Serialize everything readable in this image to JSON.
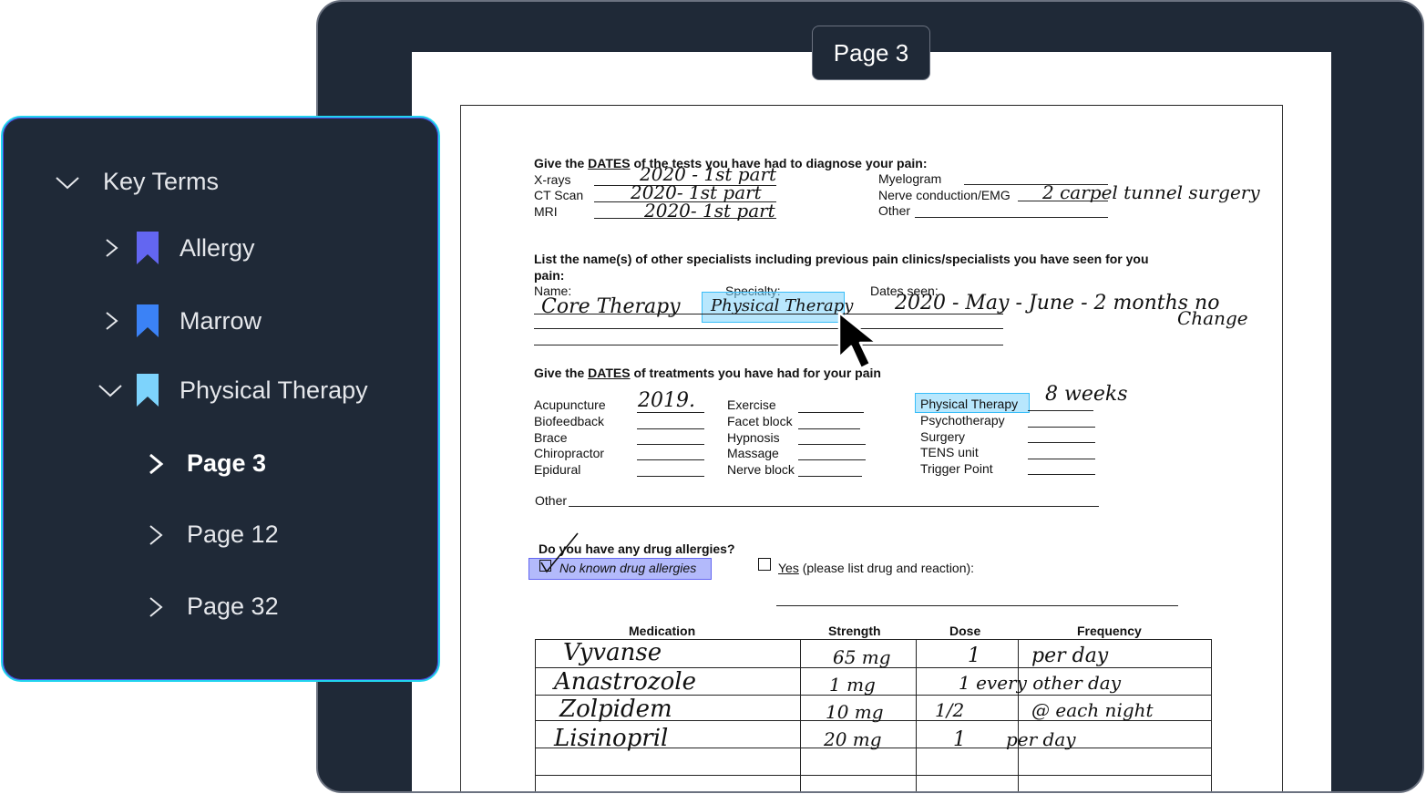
{
  "viewer": {
    "page_badge": "Page 3"
  },
  "panel": {
    "root": {
      "label": "Key Terms",
      "icon": "chevron-down-icon"
    },
    "items": [
      {
        "label": "Allergy",
        "color": "#6366f1",
        "icon": "bookmark-icon"
      },
      {
        "label": "Marrow",
        "color": "#3b82f6",
        "icon": "bookmark-icon"
      },
      {
        "label": "Physical Therapy",
        "color": "#7dd3fc",
        "icon": "bookmark-icon"
      }
    ],
    "pages": [
      {
        "label": "Page 3",
        "active": true
      },
      {
        "label": "Page 12",
        "active": false
      },
      {
        "label": "Page 32",
        "active": false
      }
    ]
  },
  "form": {
    "tests": {
      "heading_pre": "Give the ",
      "heading_dates": "DATES",
      "heading_post": " of the tests you have had to diagnose your pain:",
      "xrays": "X-rays",
      "ctscan": "CT Scan",
      "mri": "MRI",
      "myelogram": "Myelogram",
      "nerve": "Nerve conduction/EMG",
      "other": "Other",
      "hw_xrays": "2020 - 1st part",
      "hw_ct": "2020- 1st part",
      "hw_mri": "2020- 1st part",
      "hw_nerve": "2 carpel tunnel surgery"
    },
    "specialists": {
      "heading": "List the name(s) of other specialists including previous pain clinics/specialists you have seen for you",
      "heading2": "pain:",
      "name": "Name:",
      "specialty": "Specialty:",
      "dates_seen": "Dates seen:",
      "hw_name": "Core Therapy",
      "hw_specialty": "Physical Therapy",
      "hw_dates": "2020 - May - June - 2 months no",
      "hw_change": "Change"
    },
    "treatments": {
      "heading_pre": "Give the ",
      "heading_dates": "DATES",
      "heading_post": " of treatments you have had for your pain",
      "col1": [
        "Acupuncture",
        "Biofeedback",
        "Brace",
        "Chiropractor",
        "Epidural"
      ],
      "col2": [
        "Exercise",
        "Facet block",
        "Hypnosis",
        "Massage",
        "Nerve block"
      ],
      "col3": [
        "Physical Therapy",
        "Psychotherapy",
        "Surgery",
        "TENS unit",
        "Trigger Point"
      ],
      "other": "Other",
      "hw_acupuncture": "2019.",
      "hw_pt": "8 weeks"
    },
    "allergies": {
      "question": "Do you have any drug allergies?",
      "no": "No known drug allergies",
      "yes_u": "Yes",
      "yes_rest": " (please list drug and reaction):"
    },
    "medications": {
      "headers": [
        "Medication",
        "Strength",
        "Dose",
        "Frequency"
      ],
      "rows": [
        [
          "Vyvanse",
          "65 mg",
          "1",
          "per day"
        ],
        [
          "Anastrozole",
          "1 mg",
          "1 every other day",
          ""
        ],
        [
          "Zolpidem",
          "10 mg",
          "1/2",
          "@ each night"
        ],
        [
          "Lisinopril",
          "20 mg",
          "1",
          "per day"
        ]
      ]
    }
  }
}
